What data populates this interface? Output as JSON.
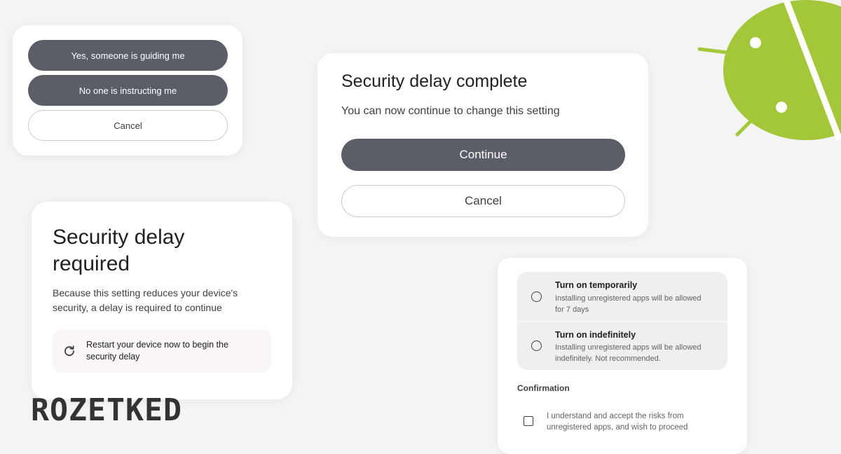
{
  "guidance_card": {
    "yes_button": "Yes, someone is guiding me",
    "no_button": "No one is instructing me",
    "cancel_button": "Cancel"
  },
  "complete_card": {
    "title": "Security delay complete",
    "message": "You can now continue to change this setting",
    "continue_button": "Continue",
    "cancel_button": "Cancel"
  },
  "required_card": {
    "title_line1": "Security delay",
    "title_line2": "required",
    "body_line1": "Because this setting reduces your device's",
    "body_line2": "security, a delay is required to continue",
    "restart_line1": "Restart your device now to begin the",
    "restart_line2": "security delay",
    "restart_icon": "restart-icon"
  },
  "options_card": {
    "options": [
      {
        "title": "Turn on temporarily",
        "desc_line1": "Installing unregistered apps will be allowed",
        "desc_line2": "for 7 days"
      },
      {
        "title": "Turn on indefinitely",
        "desc_line1": "Installing unregistered apps will be allowed",
        "desc_line2": "indefinitely. Not recommended."
      }
    ],
    "confirmation_heading": "Confirmation",
    "checkbox_line1": "I understand and accept the risks from",
    "checkbox_line2": "unregistered apps, and wish to proceed"
  },
  "brand": {
    "logo_text": "ROZETKED"
  },
  "colors": {
    "dark_button": "#5b5e66",
    "android_green": "#a4c639",
    "background": "#f4f4f4"
  }
}
